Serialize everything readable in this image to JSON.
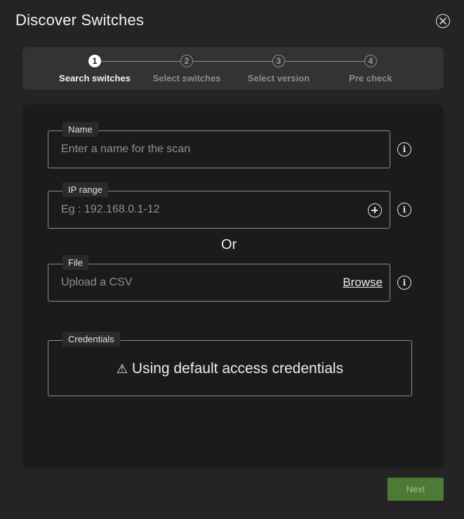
{
  "dialog": {
    "title": "Discover Switches"
  },
  "stepper": {
    "steps": [
      {
        "number": "1",
        "label": "Search switches"
      },
      {
        "number": "2",
        "label": "Select switches"
      },
      {
        "number": "3",
        "label": "Select version"
      },
      {
        "number": "4",
        "label": "Pre check"
      }
    ],
    "active_step": 1
  },
  "form": {
    "name": {
      "label": "Name",
      "placeholder": "Enter a name for the scan"
    },
    "ip_range": {
      "label": "IP range",
      "placeholder": "Eg : 192.168.0.1-12"
    },
    "separator": "Or",
    "file": {
      "label": "File",
      "placeholder": "Upload a CSV",
      "browse_label": "Browse"
    },
    "credentials": {
      "label": "Credentials",
      "message": "Using default access credentials",
      "warning_glyph": "⚠"
    }
  },
  "footer": {
    "next_label": "Next"
  },
  "colors": {
    "accent": "#4d7a35",
    "background": "#242424",
    "panel": "#1b1b1b"
  }
}
